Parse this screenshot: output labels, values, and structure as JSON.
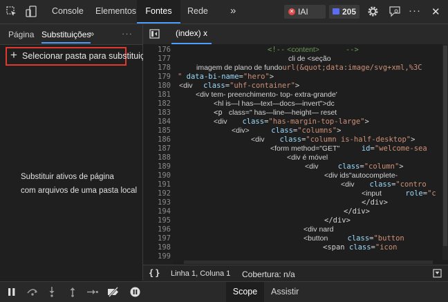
{
  "toolbar": {
    "tabs": [
      "Console",
      "Elementos",
      "Fontes",
      "Rede"
    ],
    "more_tabs": "»",
    "errors_label": "IAI",
    "messages_count": "205",
    "close": "✕",
    "ellipsis": "···"
  },
  "sources": {
    "left_tabs": [
      "Página",
      "Substituições"
    ],
    "more": "»",
    "menu": "···",
    "add_folder_label": "Selecionar pasta para substituições",
    "add_icon": "+",
    "description_line1": "Substituir ativos de página",
    "description_line2": "com arquivos de uma pasta local"
  },
  "editor": {
    "file_tab": "(index) x",
    "lines": [
      {
        "n": "176",
        "parts": [
          {
            "t": "<!--",
            "c": "cmt",
            "f": "mono"
          },
          {
            "t": " <content>",
            "c": "cmt",
            "f": "sans"
          },
          {
            "t": "      -->",
            "c": "cmt",
            "f": "mono"
          }
        ]
      },
      {
        "n": "177",
        "parts": [
          {
            "t": "cli de <seção",
            "c": "tag",
            "f": "sans"
          }
        ]
      },
      {
        "n": "178",
        "parts": [
          {
            "t": "imagem de plano de fundo",
            "c": "tag",
            "f": "sans"
          },
          {
            "t": "url(&quot;data:image/svg+xml,%3C",
            "c": "val",
            "f": "mono"
          }
        ]
      },
      {
        "n": "179",
        "parts": [
          {
            "t": "\" ",
            "c": "val",
            "f": "mono"
          },
          {
            "t": "data-bi-name",
            "c": "attr",
            "f": "mono"
          },
          {
            "t": "=",
            "c": "tag",
            "f": "mono"
          },
          {
            "t": "\"hero\"",
            "c": "val",
            "f": "mono"
          },
          {
            "t": ">",
            "c": "tag",
            "f": "mono"
          }
        ]
      },
      {
        "n": "180",
        "parts": [
          {
            "t": "<div ",
            "c": "tag",
            "f": "sans"
          },
          {
            "t": "  class",
            "c": "attr",
            "f": "mono"
          },
          {
            "t": "=",
            "c": "tag",
            "f": "mono"
          },
          {
            "t": "\"uhf-container\"",
            "c": "val",
            "f": "mono"
          },
          {
            "t": ">",
            "c": "tag",
            "f": "mono"
          }
        ]
      },
      {
        "n": "181",
        "parts": [
          {
            "t": "<div tem- preenchimento- top- extra-grande'",
            "c": "tag",
            "f": "sans"
          }
        ]
      },
      {
        "n": "182",
        "parts": [
          {
            "t": "<hl is—l has—text—docs—invert\">dc",
            "c": "tag",
            "f": "sans"
          }
        ]
      },
      {
        "n": "183",
        "parts": [
          {
            "t": "<p ",
            "c": "tag",
            "f": "mono"
          },
          {
            "t": " class=\" has—line—height— reset",
            "c": "tag",
            "f": "sans"
          }
        ]
      },
      {
        "n": "184",
        "parts": [
          {
            "t": "<div ",
            "c": "tag",
            "f": "sans"
          },
          {
            "t": "   class",
            "c": "attr",
            "f": "mono"
          },
          {
            "t": "=",
            "c": "tag",
            "f": "mono"
          },
          {
            "t": "\"has-margin-top-large\"",
            "c": "val",
            "f": "mono"
          },
          {
            "t": ">",
            "c": "tag",
            "f": "mono"
          }
        ]
      },
      {
        "n": "185",
        "parts": [
          {
            "t": "<div>",
            "c": "tag",
            "f": "sans"
          },
          {
            "t": "     class",
            "c": "attr",
            "f": "mono"
          },
          {
            "t": "=",
            "c": "tag",
            "f": "mono"
          },
          {
            "t": "\"columns\"",
            "c": "val",
            "f": "mono"
          },
          {
            "t": ">",
            "c": "tag",
            "f": "mono"
          }
        ]
      },
      {
        "n": "186",
        "parts": [
          {
            "t": "<div ",
            "c": "tag",
            "f": "sans"
          },
          {
            "t": "   class",
            "c": "attr",
            "f": "mono"
          },
          {
            "t": "=",
            "c": "tag",
            "f": "mono"
          },
          {
            "t": "\"column is-half-desktop\"",
            "c": "val",
            "f": "mono"
          },
          {
            "t": ">",
            "c": "tag",
            "f": "mono"
          }
        ]
      },
      {
        "n": "187",
        "parts": [
          {
            "t": "<form method=\"GET\"",
            "c": "tag",
            "f": "sans"
          },
          {
            "t": "     id",
            "c": "attr",
            "f": "mono"
          },
          {
            "t": "=",
            "c": "tag",
            "f": "mono"
          },
          {
            "t": "\"welcome-sea",
            "c": "val",
            "f": "mono"
          }
        ]
      },
      {
        "n": "188",
        "parts": [
          {
            "t": "<div é móvel",
            "c": "tag",
            "f": "sans"
          }
        ]
      },
      {
        "n": "189",
        "parts": [
          {
            "t": "<div ",
            "c": "tag",
            "f": "sans"
          },
          {
            "t": "    class",
            "c": "attr",
            "f": "mono"
          },
          {
            "t": "=",
            "c": "tag",
            "f": "mono"
          },
          {
            "t": "\"column\"",
            "c": "val",
            "f": "mono"
          },
          {
            "t": ">",
            "c": "tag",
            "f": "mono"
          }
        ]
      },
      {
        "n": "190",
        "parts": [
          {
            "t": "<div ids\"autocomplete-",
            "c": "tag",
            "f": "sans"
          }
        ]
      },
      {
        "n": "191",
        "parts": [
          {
            "t": "<div ",
            "c": "tag",
            "f": "sans"
          },
          {
            "t": "   class",
            "c": "attr",
            "f": "mono"
          },
          {
            "t": "=",
            "c": "tag",
            "f": "mono"
          },
          {
            "t": "\"contro",
            "c": "val",
            "f": "mono"
          }
        ]
      },
      {
        "n": "192",
        "parts": [
          {
            "t": "<input ",
            "c": "tag",
            "f": "sans"
          },
          {
            "t": "     role",
            "c": "attr",
            "f": "mono"
          },
          {
            "t": "=",
            "c": "tag",
            "f": "mono"
          },
          {
            "t": "\"c",
            "c": "val",
            "f": "mono"
          }
        ]
      },
      {
        "n": "193",
        "parts": [
          {
            "t": "</div>",
            "c": "tag",
            "f": "mono"
          }
        ]
      },
      {
        "n": "194",
        "parts": [
          {
            "t": "</div>",
            "c": "tag",
            "f": "mono"
          }
        ]
      },
      {
        "n": "195",
        "parts": [
          {
            "t": "</div>",
            "c": "tag",
            "f": "mono"
          }
        ]
      },
      {
        "n": "196",
        "parts": [
          {
            "t": "<div nard",
            "c": "tag",
            "f": "sans"
          }
        ]
      },
      {
        "n": "197",
        "parts": [
          {
            "t": "<button ",
            "c": "tag",
            "f": "sans"
          },
          {
            "t": "    class",
            "c": "attr",
            "f": "mono"
          },
          {
            "t": "=",
            "c": "tag",
            "f": "mono"
          },
          {
            "t": "\"button",
            "c": "val",
            "f": "mono"
          }
        ]
      },
      {
        "n": "198",
        "parts": [
          {
            "t": "<span ",
            "c": "tag",
            "f": "mono"
          },
          {
            "t": "class",
            "c": "attr",
            "f": "mono"
          },
          {
            "t": "=",
            "c": "tag",
            "f": "mono"
          },
          {
            "t": "\"icon",
            "c": "val",
            "f": "mono"
          }
        ]
      },
      {
        "n": "199",
        "parts": []
      }
    ]
  },
  "status": {
    "braces": "{}",
    "position": "Linha 1, Coluna 1",
    "coverage": "Cobertura: n/a"
  },
  "debugger": {
    "tabs": [
      "Scope",
      "Assistir"
    ]
  },
  "colors": {
    "accent": "#4c9eff",
    "highlight_border": "#e03a2f",
    "error_badge": "#e04a4a",
    "message_badge": "#5a6cf0"
  }
}
